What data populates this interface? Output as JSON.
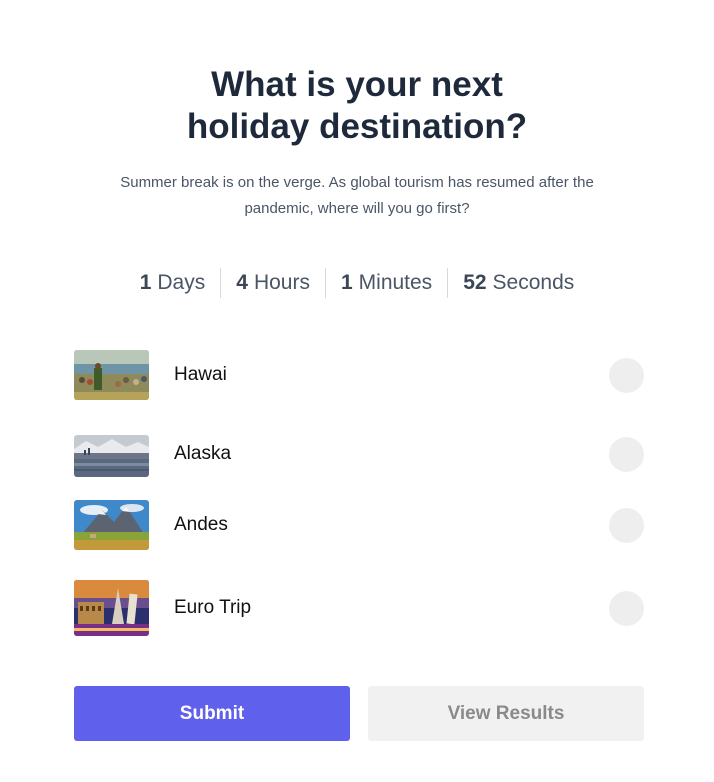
{
  "poll": {
    "title": "What is your next holiday destination?",
    "description": "Summer break is on the verge. As global tourism has resumed after the pandemic, where will you go first?"
  },
  "countdown": {
    "days": {
      "value": "1",
      "unit": "Days"
    },
    "hours": {
      "value": "4",
      "unit": "Hours"
    },
    "minutes": {
      "value": "1",
      "unit": "Minutes"
    },
    "seconds": {
      "value": "52",
      "unit": "Seconds"
    }
  },
  "options": [
    {
      "label": "Hawai",
      "selected": false
    },
    {
      "label": "Alaska",
      "selected": false
    },
    {
      "label": "Andes",
      "selected": false
    },
    {
      "label": "Euro Trip",
      "selected": false
    }
  ],
  "buttons": {
    "submit": "Submit",
    "view_results": "View Results"
  },
  "colors": {
    "accent": "#5f60ec",
    "title": "#1e2a3b",
    "radio": "#eeeeee"
  }
}
